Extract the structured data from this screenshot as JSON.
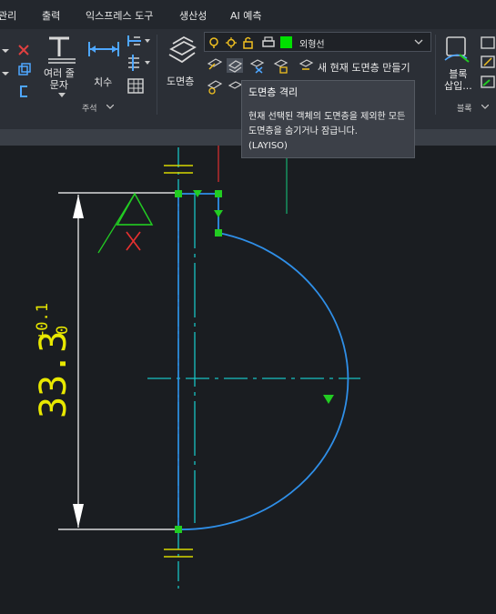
{
  "menubar": {
    "items": [
      "관리",
      "출력",
      "익스프레스 도구",
      "생산성",
      "AI 예측"
    ]
  },
  "ribbon": {
    "annotation": {
      "multiline_text_label": "여러 줄\n문자",
      "dimension_label": "치수",
      "panel_label": "주석"
    },
    "layers": {
      "layer_button_label": "도면층",
      "current_layer_name": "외형선",
      "current_layer_color": "#00e000",
      "make_current_label": "새 현재 도면층 만들기"
    },
    "block": {
      "insert_label": "블록\n삽입...",
      "panel_label": "블록"
    }
  },
  "tooltip": {
    "title": "도면층 격리",
    "body": "현재 선택된 객체의 도면층을 제외한 모든 도면층을 숨기거나 잠급니다.",
    "command": "(LAYISO)"
  },
  "canvas": {
    "dimension_text": "33.3",
    "tolerance_upper": "+0.1",
    "tolerance_lower": "0",
    "colors": {
      "background": "#1a1d21",
      "profile_line": "#2f8fe8",
      "center_line": "#17c3c3",
      "dimension": "#ffffff",
      "dimension_text": "#e8e800",
      "grip": "#22cc22",
      "datum_triangle": "#22cc22",
      "datum_x": "#e83030",
      "construction_red": "#e03030",
      "construction_green": "#16b070",
      "hatch_marks": "#d8d800"
    }
  }
}
